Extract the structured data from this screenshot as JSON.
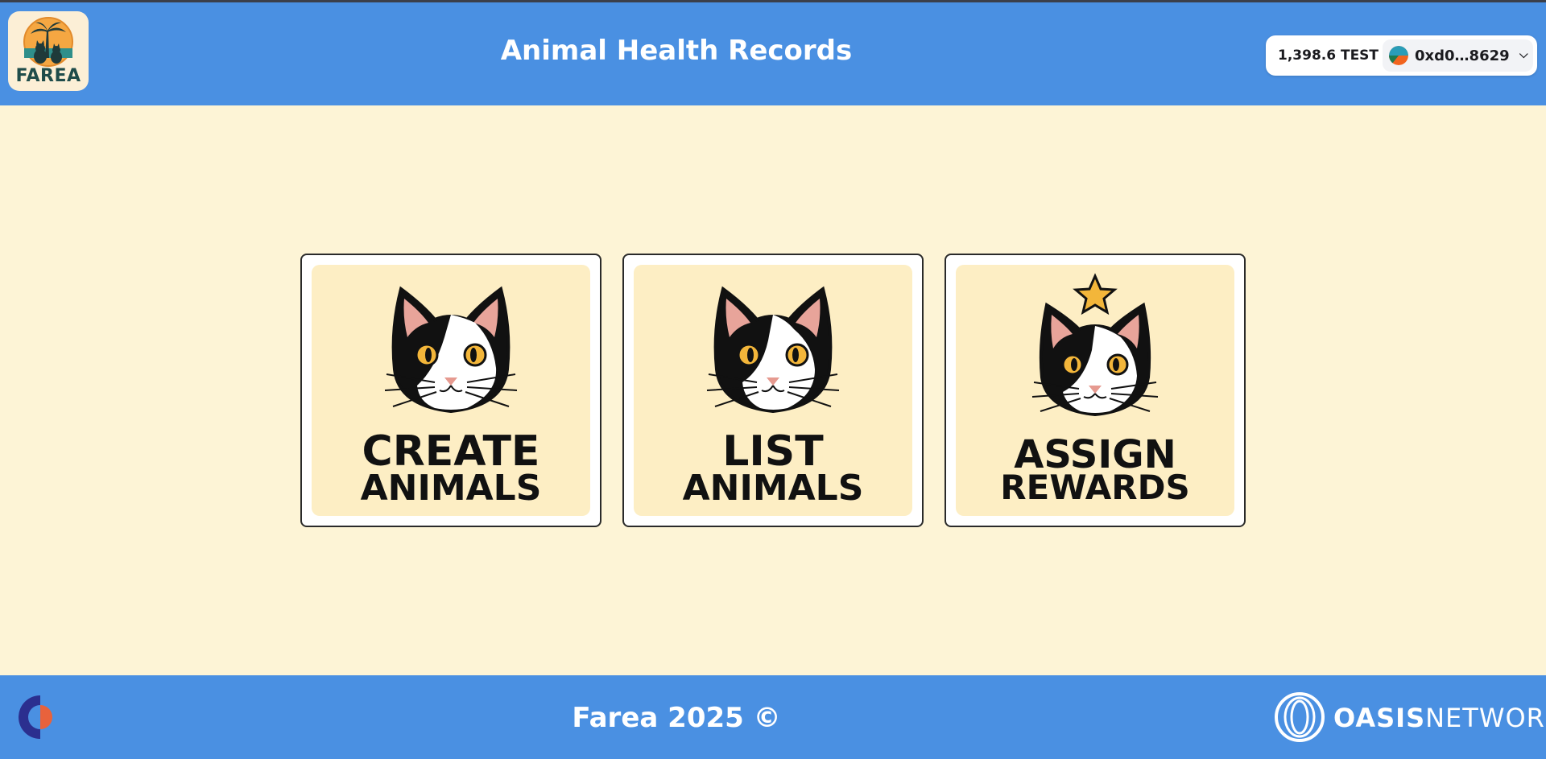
{
  "header": {
    "logo_text": "FAREA",
    "title": "Animal Health Records",
    "wallet": {
      "balance": "1,398.6 TEST",
      "address": "0xd0…8629",
      "chevron": "chevron-down-icon"
    }
  },
  "cards": [
    {
      "line1": "CREATE",
      "line2": "ANIMALS",
      "icon": "cat-icon"
    },
    {
      "line1": "LIST",
      "line2": "ANIMALS",
      "icon": "cat-icon"
    },
    {
      "line1": "ASSIGN",
      "line2": "REWARDS",
      "icon": "cat-star-icon"
    }
  ],
  "footer": {
    "text": "Farea 2025 ©",
    "partner_brand": "OASIS",
    "partner_suffix": "NETWORK"
  },
  "colors": {
    "primary": "#4a90e2",
    "background": "#fdf4d6",
    "card_inner": "#fdeec4",
    "text_dark": "#111111"
  }
}
